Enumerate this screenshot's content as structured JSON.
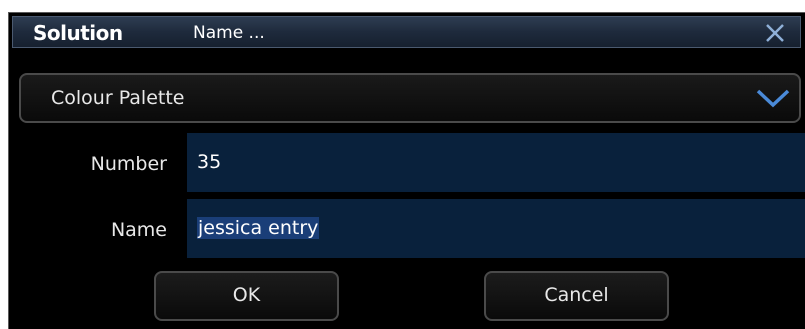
{
  "titlebar": {
    "brand": "Solution",
    "title": "Name ..."
  },
  "dropdown": {
    "selected": "Colour Palette"
  },
  "fields": {
    "number_label": "Number",
    "number_value": "35",
    "name_label": "Name",
    "name_value": "jessica entry"
  },
  "buttons": {
    "ok": "OK",
    "cancel": "Cancel"
  },
  "colors": {
    "titlebar": "#1e2a3c",
    "input_bg": "#09213c",
    "selection": "#1a3e78",
    "chevron": "#4a8ad8",
    "close": "#8fb0d8"
  },
  "icons": {
    "close": "close-icon",
    "dropdown": "chevron-down-icon"
  }
}
